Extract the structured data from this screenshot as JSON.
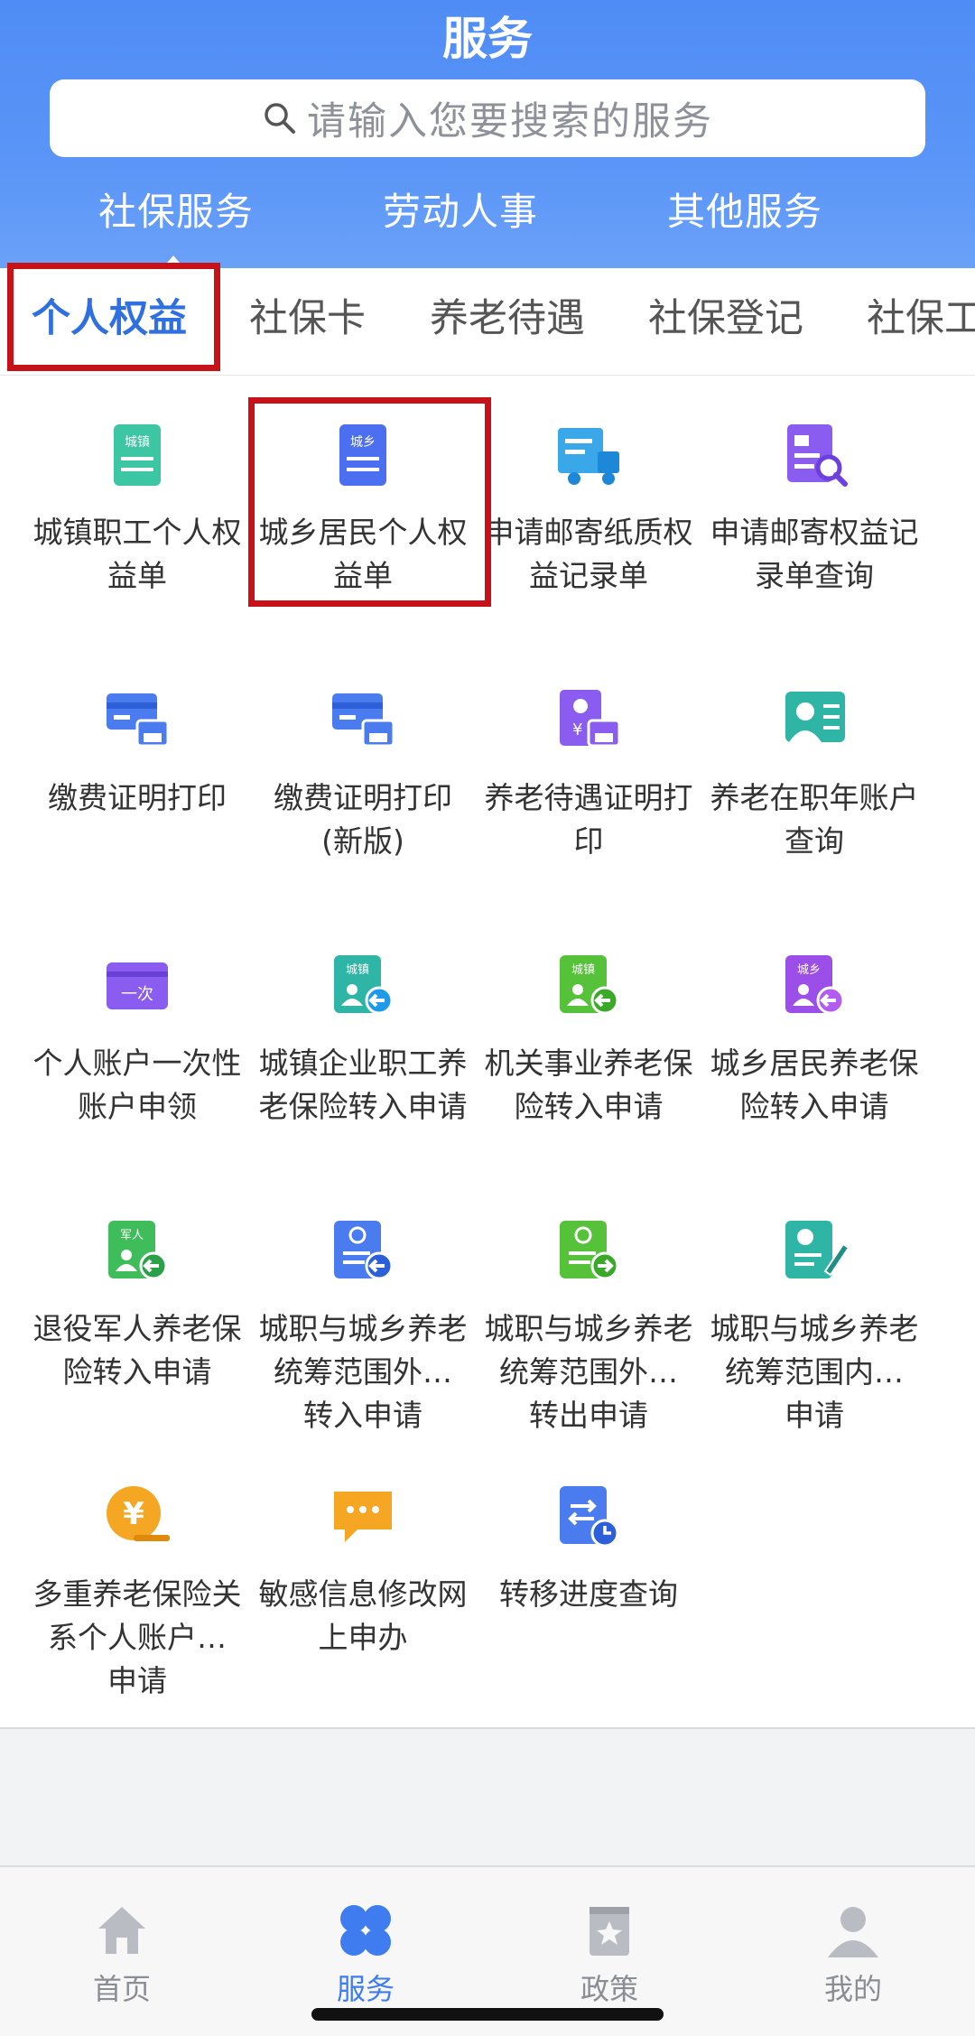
{
  "header": {
    "title": "服务",
    "search_placeholder": "请输入您要搜索的服务",
    "tabs": [
      "社保服务",
      "劳动人事",
      "其他服务"
    ]
  },
  "sub_tabs": [
    "个人权益",
    "社保卡",
    "养老待遇",
    "社保登记",
    "社保工"
  ],
  "services": [
    {
      "line1": "城镇职工个人权",
      "line2": "益单",
      "line3": "",
      "icon": "town-doc-icon"
    },
    {
      "line1": "城乡居民个人权",
      "line2": "益单",
      "line3": "",
      "icon": "rural-doc-icon"
    },
    {
      "line1": "申请邮寄纸质权",
      "line2": "益记录单",
      "line3": "",
      "icon": "mail-truck-icon"
    },
    {
      "line1": "申请邮寄权益记",
      "line2": "录单查询",
      "line3": "",
      "icon": "doc-search-icon"
    },
    {
      "line1": "缴费证明打印",
      "line2": "",
      "line3": "",
      "icon": "payment-print-icon"
    },
    {
      "line1": "缴费证明打印",
      "line2": "(新版)",
      "line3": "",
      "icon": "payment-print-new-icon"
    },
    {
      "line1": "养老待遇证明打",
      "line2": "印",
      "line3": "",
      "icon": "pension-print-icon"
    },
    {
      "line1": "养老在职年账户",
      "line2": "查询",
      "line3": "",
      "icon": "account-query-icon"
    },
    {
      "line1": "个人账户一次性",
      "line2": "账户申领",
      "line3": "",
      "icon": "one-time-card-icon"
    },
    {
      "line1": "城镇企业职工养",
      "line2": "老保险转入申请",
      "line3": "",
      "icon": "town-transfer-in-icon"
    },
    {
      "line1": "机关事业养老保",
      "line2": "险转入申请",
      "line3": "",
      "icon": "gov-transfer-in-icon"
    },
    {
      "line1": "城乡居民养老保",
      "line2": "险转入申请",
      "line3": "",
      "icon": "rural-transfer-in-icon"
    },
    {
      "line1": "退役军人养老保",
      "line2": "险转入申请",
      "line3": "",
      "icon": "veteran-transfer-in-icon"
    },
    {
      "line1": "城职与城乡养老",
      "line2": "统筹范围外…",
      "line3": "转入申请",
      "icon": "cross-transfer-in-icon"
    },
    {
      "line1": "城职与城乡养老",
      "line2": "统筹范围外…",
      "line3": "转出申请",
      "icon": "cross-transfer-out-icon"
    },
    {
      "line1": "城职与城乡养老",
      "line2": "统筹范围内…",
      "line3": "申请",
      "icon": "inner-apply-icon"
    },
    {
      "line1": "多重养老保险关",
      "line2": "系个人账户…",
      "line3": "申请",
      "icon": "yuan-coin-icon"
    },
    {
      "line1": "敏感信息修改网",
      "line2": "上申办",
      "line3": "",
      "icon": "chat-edit-icon"
    },
    {
      "line1": "转移进度查询",
      "line2": "",
      "line3": "",
      "icon": "progress-query-icon"
    }
  ],
  "icon_badges": {
    "town": "城镇",
    "rural": "城乡",
    "veteran": "军人",
    "once": "一次"
  },
  "bottom_nav": [
    "首页",
    "服务",
    "政策",
    "我的"
  ],
  "colors": {
    "accent": "#3e7cf0",
    "header": "#5a95f7",
    "highlight_box": "#c8121a"
  }
}
